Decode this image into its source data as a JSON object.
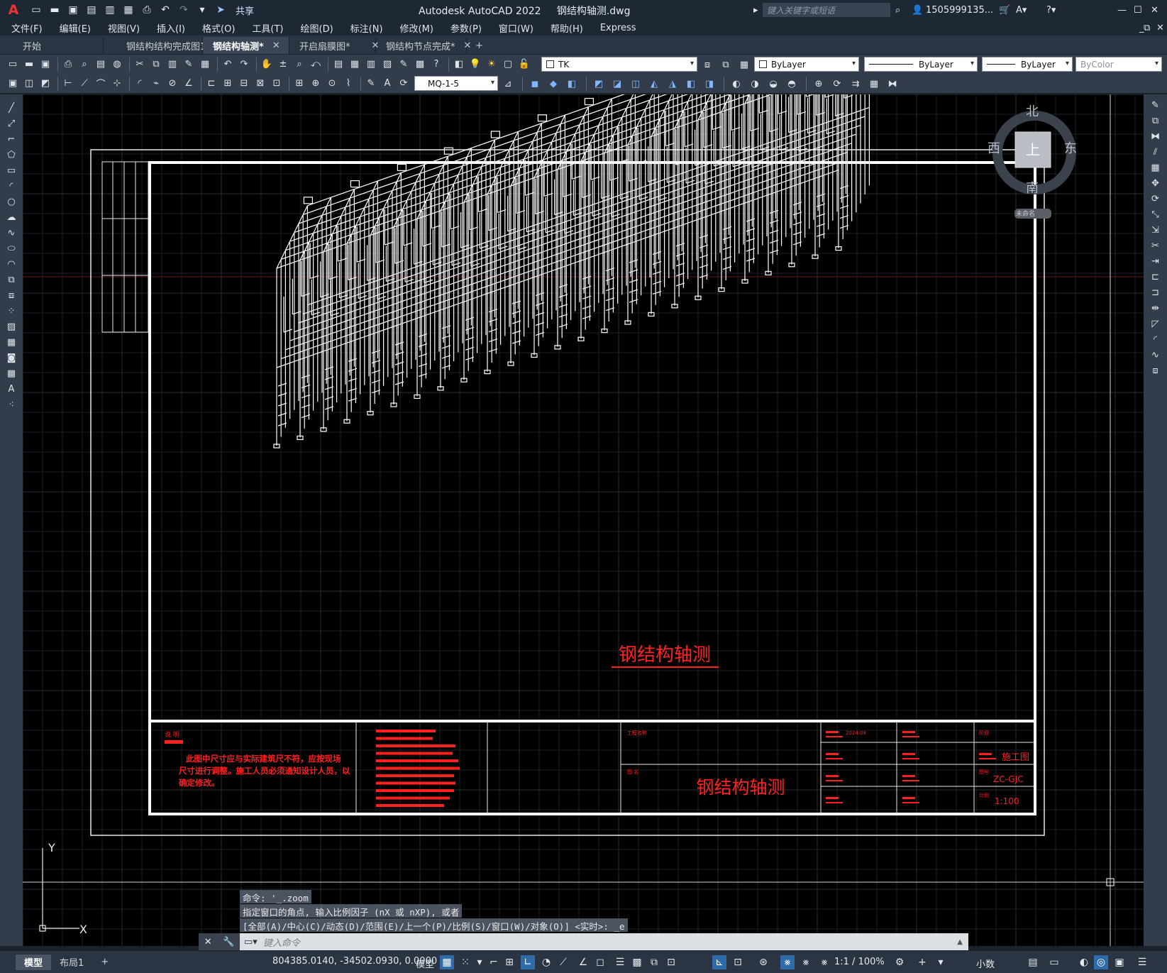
{
  "app": {
    "title": "Autodesk AutoCAD 2022",
    "filename": "钢结构轴测.dwg",
    "logo": "A",
    "share_label": "共享",
    "search_placeholder": "键入关键字或短语",
    "user": "1505999135..."
  },
  "menu": [
    "文件(F)",
    "编辑(E)",
    "视图(V)",
    "插入(I)",
    "格式(O)",
    "工具(T)",
    "绘图(D)",
    "标注(N)",
    "修改(M)",
    "参数(P)",
    "窗口(W)",
    "帮助(H)",
    "Express"
  ],
  "tabs": [
    {
      "label": "开始",
      "active": false,
      "closable": false
    },
    {
      "label": "钢结构结构完成图1",
      "active": false,
      "closable": true
    },
    {
      "label": "钢结构轴测*",
      "active": true,
      "closable": true
    },
    {
      "label": "开启扇膜图*",
      "active": false,
      "closable": true
    },
    {
      "label": "钢结构节点完成*",
      "active": false,
      "closable": true
    }
  ],
  "properties": {
    "layer": "TK",
    "color": "ByLayer",
    "linetype": "ByLayer",
    "lineweight": "ByLayer",
    "plotstyle": "ByColor",
    "dimstyle": "MQ-1-5"
  },
  "viewcube": {
    "north": "北",
    "south": "南",
    "east": "东",
    "west": "西",
    "top": "上",
    "wcs": "未命名"
  },
  "drawing": {
    "caption": "钢结构轴测",
    "title_block": {
      "note_heading": "说 明",
      "note_text_1": "此图中尺寸应与实际建筑尺不符，应按现场",
      "note_text_2": "尺寸进行调整。施工人员必须通知设计人员，以",
      "note_text_3": "确定修改。",
      "project_label": "工程名称",
      "drawing_name_label": "图 名",
      "drawing_name": "钢结构轴测",
      "date_value": "2024.08",
      "phase_label": "阶段",
      "phase_value": "施工图",
      "number_label": "图号",
      "number_value": "ZC-GJC",
      "scale_label": "比例",
      "scale_value": "1:100"
    }
  },
  "command": {
    "history": [
      "命令: '_.zoom",
      "指定窗口的角点, 输入比例因子 (nX 或 nXP), 或者",
      "[全部(A)/中心(C)/动态(D)/范围(E)/上一个(P)/比例(S)/窗口(W)/对象(O)] <实时>: _e"
    ],
    "placeholder": "键入命令"
  },
  "ucs": {
    "x": "X",
    "y": "Y"
  },
  "status": {
    "layouts": [
      {
        "label": "模型",
        "active": true
      },
      {
        "label": "布局1",
        "active": false
      }
    ],
    "add": "+",
    "coords": "804385.0140, -34502.0930, 0.0000",
    "space": "模型",
    "scale": "1:1 / 100%",
    "units": "小数"
  },
  "colors": {
    "canvas": "#000000",
    "grid": "#2a2f36",
    "structure": "#ffffff",
    "annotation": "#ff2020",
    "accent": "#2e6ba8"
  }
}
